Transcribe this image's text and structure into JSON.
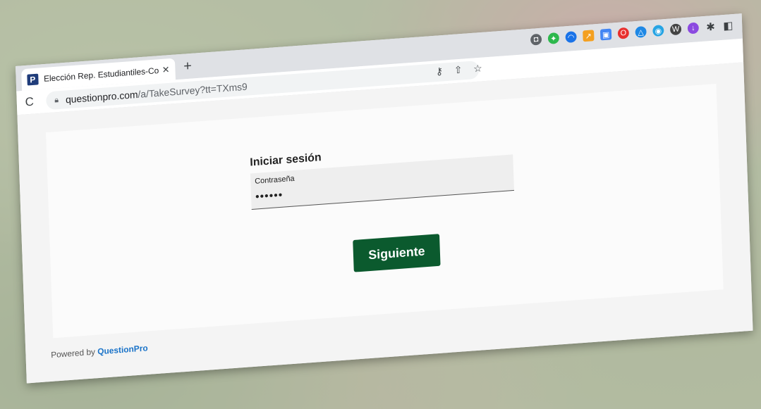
{
  "browser": {
    "tab": {
      "favicon_letter": "P",
      "title": "Elección Rep. Estudiantiles-Co",
      "close_symbol": "✕"
    },
    "new_tab_symbol": "+",
    "url_host": "questionpro.com",
    "url_path": "/a/TakeSurvey?tt=TXms9",
    "reload_symbol": "C",
    "extensions": [
      {
        "name": "camera-icon",
        "glyph": "◘",
        "color": "#5f6368"
      },
      {
        "name": "evernote-icon",
        "glyph": "✦",
        "color": "#2db84d"
      },
      {
        "name": "cloud-icon",
        "glyph": "◠",
        "color": "#1a73e8"
      },
      {
        "name": "chart-icon",
        "glyph": "↗",
        "color": "#f4a020"
      },
      {
        "name": "tab-icon",
        "glyph": "▣",
        "color": "#4285f4"
      },
      {
        "name": "opera-icon",
        "glyph": "O",
        "color": "#e8312f"
      },
      {
        "name": "drive-icon",
        "glyph": "△",
        "color": "#1e88e5"
      },
      {
        "name": "chat-icon",
        "glyph": "◉",
        "color": "#26a4e4"
      },
      {
        "name": "grammar-icon",
        "glyph": "W",
        "color": "#444444"
      },
      {
        "name": "download-icon",
        "glyph": "↓",
        "color": "#8b4ae0"
      }
    ]
  },
  "page": {
    "form_title": "Iniciar sesión",
    "password_label": "Contraseña",
    "password_value": "••••••",
    "next_button": "Siguiente",
    "footer_prefix": "Powered by",
    "footer_brand": "QuestionPro"
  },
  "colors": {
    "button": "#0b5a2e",
    "brand_link": "#1a73c8"
  }
}
